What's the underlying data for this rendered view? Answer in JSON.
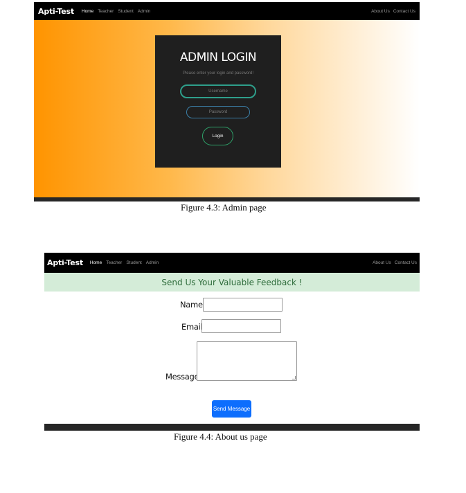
{
  "admin_page": {
    "navbar": {
      "brand": "Apti-Test",
      "links": [
        "Home",
        "Teacher",
        "Student",
        "Admin"
      ],
      "right_links": [
        "About Us",
        "Contact Us"
      ]
    },
    "login": {
      "title": "ADMIN LOGIN",
      "subtitle": "Please enter your login and password!",
      "username_placeholder": "Username",
      "password_placeholder": "Password",
      "button": "Login"
    },
    "caption": "Figure 4.3: Admin page"
  },
  "about_page": {
    "navbar": {
      "brand": "Apti-Test",
      "links": [
        "Home",
        "Teacher",
        "Student",
        "Admin"
      ],
      "right_links": [
        "About Us",
        "Contact Us"
      ]
    },
    "banner": "Send Us Your Valuable Feedback !",
    "form": {
      "name_label": "Name:",
      "email_label": "Email:",
      "message_label": "Message:",
      "submit": "Send Message"
    },
    "caption": "Figure 4.4: About us page"
  },
  "colors": {
    "gradient_start": "#ff9400",
    "navbar": "#000000",
    "login_box": "#1f1f1f",
    "username_border": "#2e9f8b",
    "password_border": "#3b7fa8",
    "login_border": "#2ea36a",
    "banner_bg": "#d4ecd8",
    "banner_text": "#2d6b3a",
    "send_button": "#0d6efd"
  }
}
